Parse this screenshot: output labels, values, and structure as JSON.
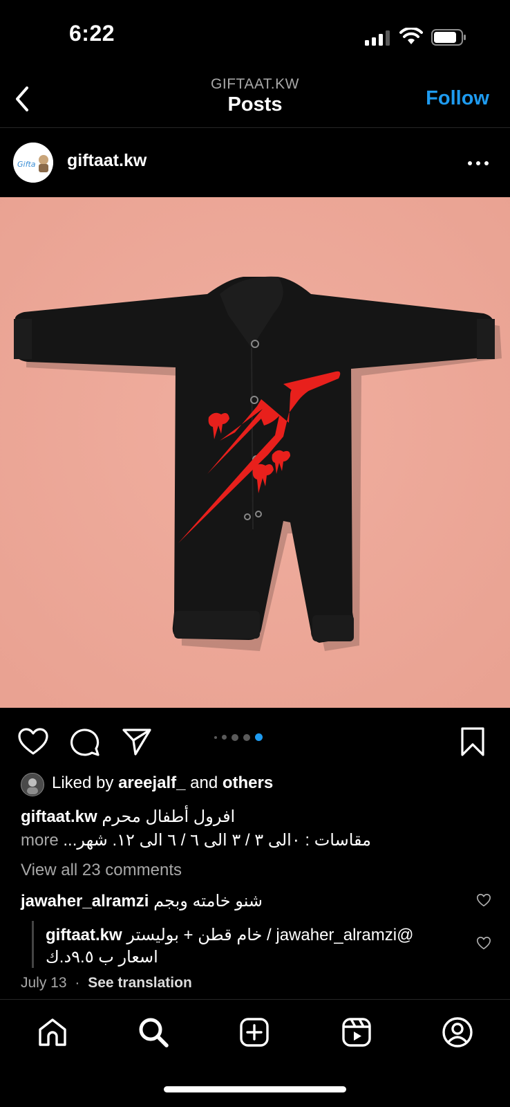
{
  "status_bar": {
    "time": "6:22"
  },
  "header": {
    "subtitle": "GIFTAAT.KW",
    "title": "Posts",
    "follow_label": "Follow"
  },
  "post": {
    "username": "giftaat.kw",
    "avatar_text": "Gifta",
    "carousel_count": 5,
    "carousel_active": 5,
    "likes_prefix": "Liked by",
    "likes_user": "areejalf_",
    "likes_and": "and",
    "likes_suffix": "others",
    "caption_user": "giftaat.kw",
    "caption_line1": "افرول أطفال محرم",
    "caption_line2": "مقاسات : ٠الى ٣ / ٣ الى ٦ / ٦ الى ١٢. شهر...",
    "caption_more": "more",
    "view_comments": "View all 23 comments",
    "comment_user": "jawaher_alramzi",
    "comment_text": "شنو خامته وبجم",
    "reply_user": "giftaat.kw",
    "reply_text_line1": "@jawaher_alramzi / خام قطن + بوليستر",
    "reply_text_line2": "اسعار ب ٩.٥د.ك",
    "date": "July 13",
    "date_sep": "·",
    "see_translation": "See translation"
  },
  "image": {
    "background": "#eda89a",
    "garment": "#141414",
    "print": "#e8201c"
  },
  "colors": {
    "accent": "#1e9bf0"
  }
}
